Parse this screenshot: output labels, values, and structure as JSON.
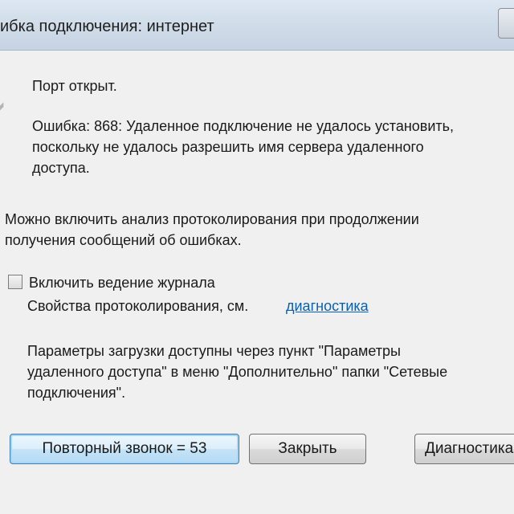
{
  "window": {
    "title": "ибка подключения: интернет"
  },
  "message": {
    "status": "Порт открыт.",
    "error_lines": [
      "Ошибка: 868: Удаленное подключение не удалось установить,",
      "поскольку не удалось разрешить имя сервера удаленного",
      "доступа."
    ]
  },
  "logging": {
    "info_lines": [
      "Можно включить анализ протоколирования при продолжении",
      "получения сообщений об ошибках."
    ],
    "checkbox_label": "Включить ведение журнала",
    "checkbox_checked": false,
    "properties_text": "Свойства протоколирования, см.",
    "properties_link": "диагностика"
  },
  "settings": {
    "lines": [
      "Параметры загрузки доступны через пункт \"Параметры",
      "удаленного доступа\" в меню \"Дополнительно\" папки \"Сетевые",
      "подключения\"."
    ]
  },
  "buttons": {
    "redial": "Повторный звонок = 53",
    "close": "Закрыть",
    "diagnostics": "Диагностика"
  }
}
